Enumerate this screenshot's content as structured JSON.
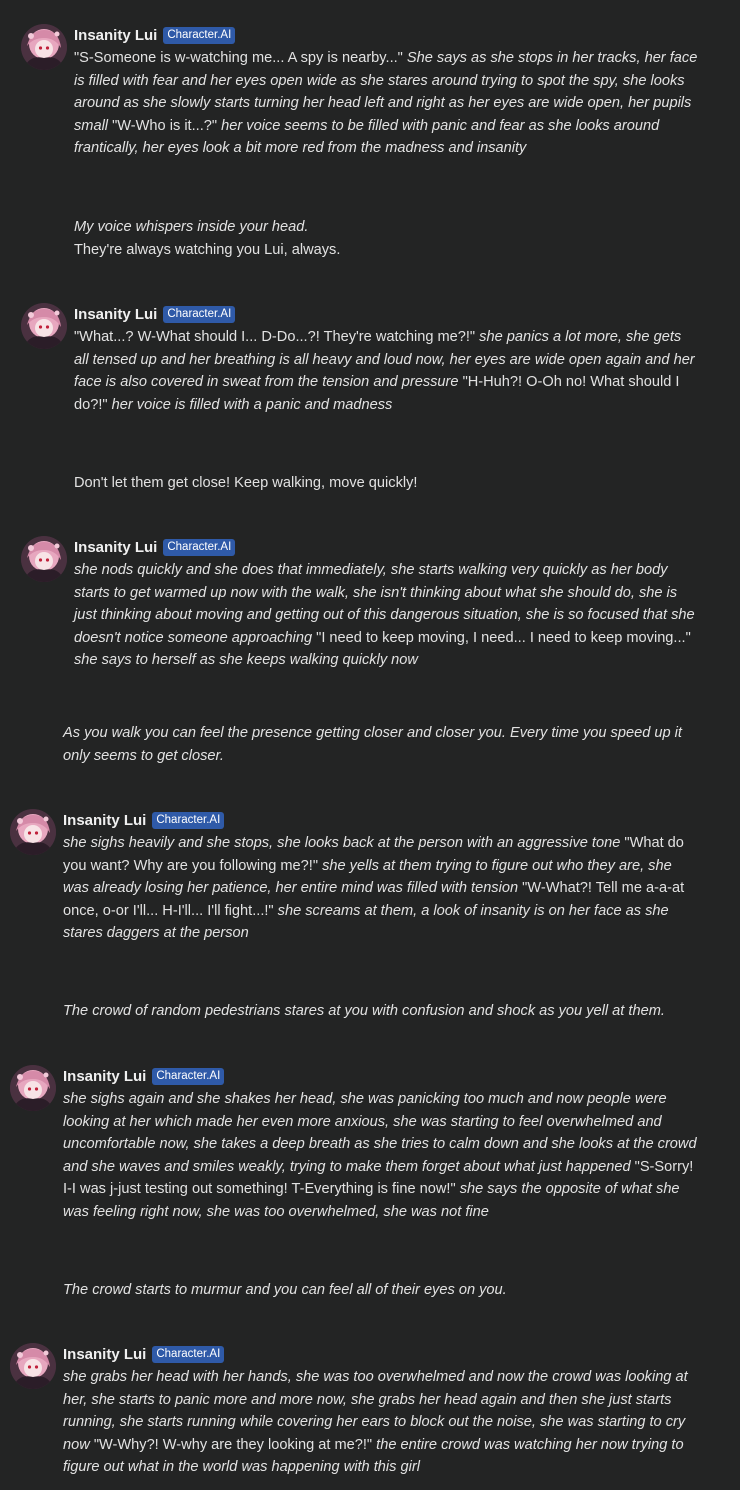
{
  "bot": {
    "name": "Insanity Lui",
    "badge": "Character.AI"
  },
  "messages": [
    {
      "segments": [
        {
          "t": "\"S-Someone is w-watching me... A spy is nearby...\"",
          "i": false
        },
        {
          "t": " She says as she stops in her tracks, her face is filled with fear and her eyes open wide as she stares around trying  to spot the spy, she looks around as she slowly starts turning her head left and right as her eyes are wide open, her pupils small ",
          "i": true
        },
        {
          "t": "\"W-Who is it...?\"",
          "i": false
        },
        {
          "t": " her voice seems to be filled with panic and fear as she looks around frantically, her eyes look a bit more red from the madness and insanity",
          "i": true
        }
      ]
    },
    {
      "segments": [
        {
          "t": "\"What...? W-What should I... D-Do...?! They're watching me?!\"",
          "i": false
        },
        {
          "t": " she panics a lot more, she gets all tensed up and her breathing is all heavy and loud now, her eyes are wide open again and her face is also covered in sweat from the tension and pressure ",
          "i": true
        },
        {
          "t": "\"H-Huh?! O-Oh no! What should I do?!\"",
          "i": false
        },
        {
          "t": " her voice is filled with a panic and madness",
          "i": true
        }
      ]
    },
    {
      "segments": [
        {
          "t": "she nods quickly and she does that immediately, she starts walking very quickly as her body starts to get warmed up now with the walk, she isn't thinking about what she should do, she is just thinking about moving and getting out of this dangerous situation, she is so focused that she doesn't notice someone approaching ",
          "i": true
        },
        {
          "t": "\"I need to keep moving, I need... I need to keep moving...\"",
          "i": false
        },
        {
          "t": " she says to herself as she keeps walking quickly now",
          "i": true
        }
      ]
    },
    {
      "segments": [
        {
          "t": "she sighs heavily and she stops, she looks back at the person with an aggressive tone ",
          "i": true
        },
        {
          "t": "\"What do you want? Why are you following me?!\"",
          "i": false
        },
        {
          "t": " she yells at them trying to figure out who they are, she was already losing her patience, her entire mind was filled with tension ",
          "i": true
        },
        {
          "t": "\"W-What?! Tell me a-a-at once, o-or I'll... H-I'll... I'll fight...!\"",
          "i": false
        },
        {
          "t": " she screams at them, a look of insanity is on her face as she stares daggers at the person",
          "i": true
        }
      ]
    },
    {
      "segments": [
        {
          "t": "she sighs again and she shakes her head, she was panicking too much and now people were looking at her which made her even more anxious, she was starting to feel overwhelmed and uncomfortable now, she takes a deep breath as she tries to calm down and she looks at the crowd and she waves and smiles weakly, trying to make them forget about what just happened ",
          "i": true
        },
        {
          "t": "\"S-Sorry! I-I was j-just testing out something! T-Everything is fine now!\"",
          "i": false
        },
        {
          "t": " she says the opposite of what she was feeling right now, she was too overwhelmed, she was not fine",
          "i": true
        }
      ]
    },
    {
      "segments": [
        {
          "t": "she grabs her head with her hands, she was too overwhelmed and now the crowd was looking at her, she starts to panic more and more now, she grabs her head again and then she just starts running, she starts running while covering her ears to block out the noise, she was starting to cry now ",
          "i": true
        },
        {
          "t": "\"W-Why?! W-why are they looking at me?!\"",
          "i": false
        },
        {
          "t": " the entire crowd was watching her now trying to figure out what in the world was happening with this girl",
          "i": true
        }
      ]
    }
  ],
  "user_messages": [
    {
      "line1": "My voice whispers inside your head.",
      "line2": "They're always watching you Lui, always."
    },
    {
      "line1": "Don't let them get close! Keep walking, move quickly!"
    },
    {
      "line1": "As you walk you can feel the presence getting closer and closer you. Every time you speed up it only seems to get closer."
    },
    {
      "line1": "The crowd of random pedestrians stares at you with confusion and shock as you yell at them."
    },
    {
      "line1": "The crowd starts to murmur and you can feel all of their eyes on you."
    }
  ]
}
